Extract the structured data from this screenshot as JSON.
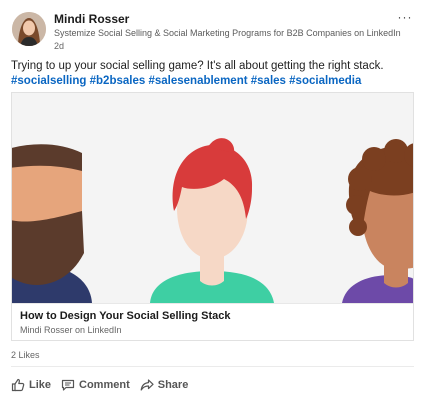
{
  "author": {
    "name": "Mindi Rosser",
    "headline": "Systemize Social Selling & Social Marketing Programs for B2B Companies on LinkedIn",
    "time": "2d"
  },
  "menu": {
    "more_icon": "···"
  },
  "post": {
    "text": "Trying to up your social selling game? It's all about getting the right stack.",
    "hashtags": [
      "#socialselling",
      "#b2bsales",
      "#salesenablement",
      "#sales",
      "#socialmedia"
    ]
  },
  "card": {
    "title": "How to Design Your Social Selling Stack",
    "source": "Mindi Rosser on LinkedIn"
  },
  "social": {
    "likes": "2 Likes"
  },
  "actions": {
    "like": "Like",
    "comment": "Comment",
    "share": "Share"
  },
  "colors": {
    "hashtag": "#0a66c2",
    "beard": "#5b3b2c",
    "shirt_navy": "#2e3a6b",
    "red_hair": "#d83b3b",
    "shirt_green": "#3ecfa3",
    "curly_hair": "#7b3f20",
    "shirt_purple": "#6d4aa8",
    "skin_light": "#f6d8c6",
    "skin_tan": "#e6a57c",
    "skin_brown": "#c9845f"
  },
  "icons": [
    "more-icon",
    "like-icon",
    "comment-icon",
    "share-icon"
  ]
}
